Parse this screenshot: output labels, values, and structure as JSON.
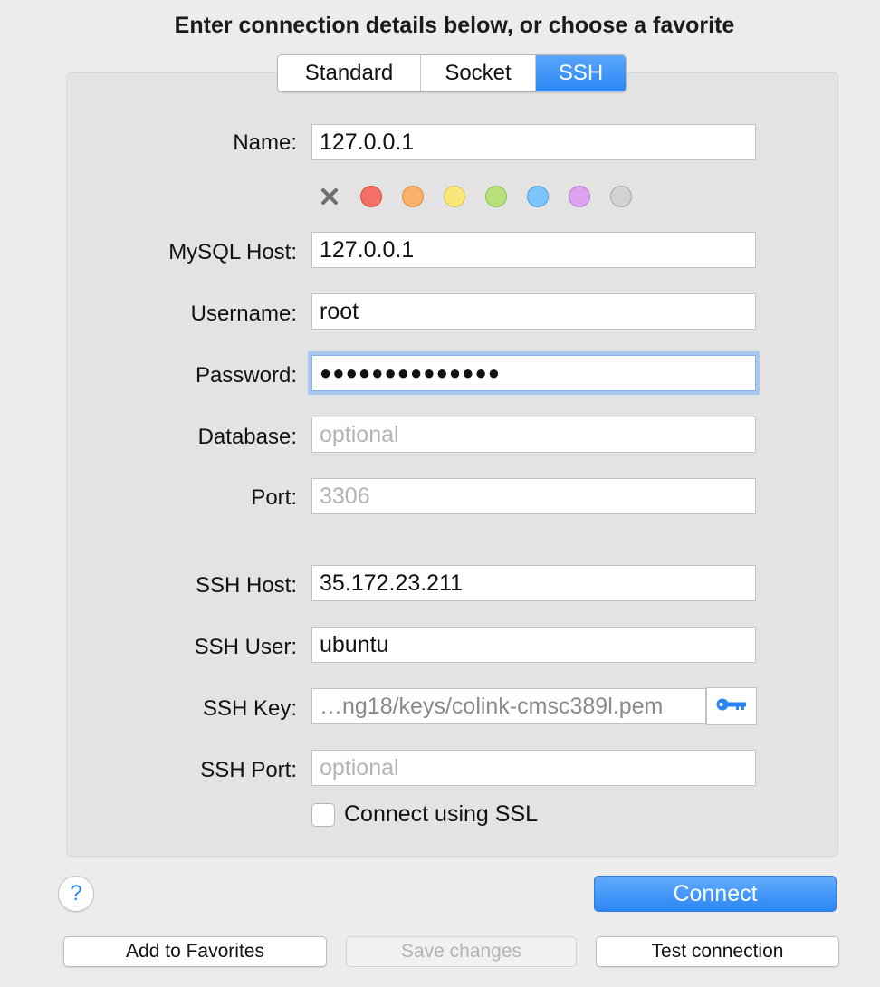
{
  "heading": "Enter connection details below, or choose a favorite",
  "tabs": [
    {
      "label": "Standard",
      "active": false
    },
    {
      "label": "Socket",
      "active": false
    },
    {
      "label": "SSH",
      "active": true
    }
  ],
  "form": {
    "name_label": "Name:",
    "name_value": "127.0.0.1",
    "mysql_host_label": "MySQL Host:",
    "mysql_host_value": "127.0.0.1",
    "username_label": "Username:",
    "username_value": "root",
    "password_label": "Password:",
    "password_value": "●●●●●●●●●●●●●●",
    "database_label": "Database:",
    "database_placeholder": "optional",
    "port_label": "Port:",
    "port_placeholder": "3306",
    "ssh_host_label": "SSH Host:",
    "ssh_host_value": "35.172.23.211",
    "ssh_user_label": "SSH User:",
    "ssh_user_value": "ubuntu",
    "ssh_key_label": "SSH Key:",
    "ssh_key_value": "…ng18/keys/colink-cmsc389l.pem",
    "ssh_port_label": "SSH Port:",
    "ssh_port_placeholder": "optional",
    "ssl_label": "Connect using SSL",
    "ssl_checked": false
  },
  "colors": [
    {
      "name": "none",
      "icon": "x-mark-icon",
      "hex": "#6e6e6e"
    },
    {
      "name": "red",
      "fill": "#f47067",
      "stroke": "#d84a43"
    },
    {
      "name": "orange",
      "fill": "#f8b06a",
      "stroke": "#e08c3c"
    },
    {
      "name": "yellow",
      "fill": "#f9e77c",
      "stroke": "#dcc44c"
    },
    {
      "name": "green",
      "fill": "#b6e07a",
      "stroke": "#8fbf4f"
    },
    {
      "name": "blue",
      "fill": "#7dc4fa",
      "stroke": "#4b9fdc"
    },
    {
      "name": "purple",
      "fill": "#dba4ef",
      "stroke": "#b97ad3"
    },
    {
      "name": "gray",
      "fill": "#d2d2d2",
      "stroke": "#a6a6a6"
    }
  ],
  "buttons": {
    "help": "?",
    "connect": "Connect",
    "add_favorites": "Add to Favorites",
    "save_changes": "Save changes",
    "test_connection": "Test connection"
  },
  "accent": "#2a86f5",
  "key_icon": "key-icon"
}
